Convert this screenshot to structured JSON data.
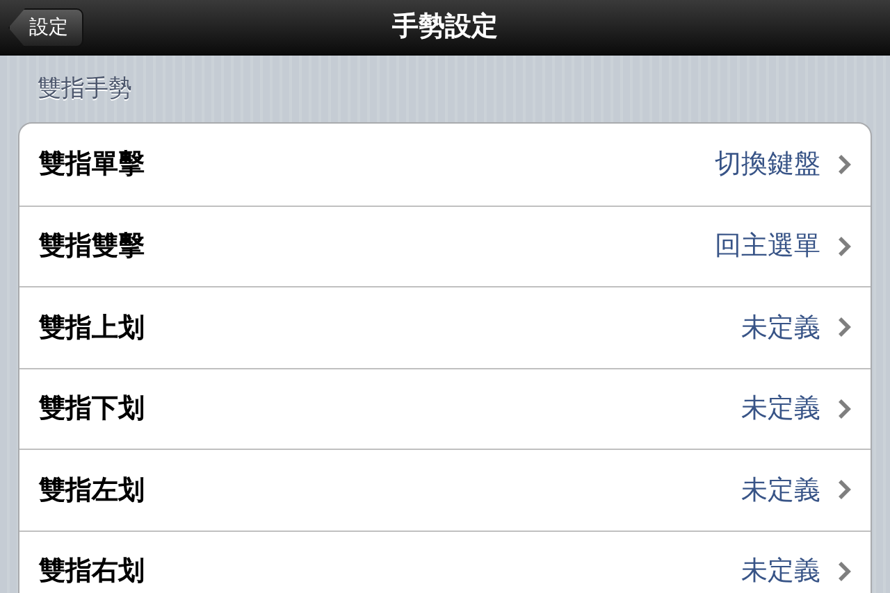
{
  "nav_bar": {
    "back_button": "設定",
    "title": "手勢設定"
  },
  "section": {
    "header": "雙指手勢",
    "rows": [
      {
        "label": "雙指單擊",
        "value": "切換鍵盤"
      },
      {
        "label": "雙指雙擊",
        "value": "回主選單"
      },
      {
        "label": "雙指上划",
        "value": "未定義"
      },
      {
        "label": "雙指下划",
        "value": "未定義"
      },
      {
        "label": "雙指左划",
        "value": "未定義"
      },
      {
        "label": "雙指右划",
        "value": "未定義"
      }
    ]
  }
}
